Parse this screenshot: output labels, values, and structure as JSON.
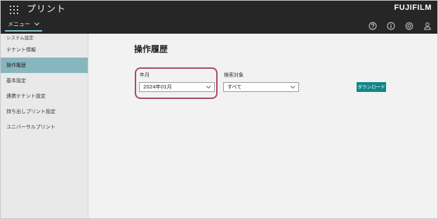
{
  "header": {
    "app_title": "プリント",
    "brand": "FUJIFILM",
    "menu_label": "メニュー"
  },
  "sidebar": {
    "section_label": "システム設定",
    "items": [
      {
        "label": "テナント情報"
      },
      {
        "label": "操作履歴"
      },
      {
        "label": "基本設定"
      },
      {
        "label": "連携テナント設定"
      },
      {
        "label": "持ち出しプリント設定"
      },
      {
        "label": "ユニバーサルプリント"
      }
    ],
    "active_index": 1
  },
  "main": {
    "title": "操作履歴",
    "year_month": {
      "label": "年月",
      "value": "2024年01月"
    },
    "target": {
      "label": "検索対象",
      "value": "すべて"
    },
    "download_label": "ダウンロード"
  },
  "colors": {
    "topbar": "#262626",
    "active_sidebar": "#88b6bf",
    "download_button": "#13858a",
    "highlight_outline": "#a44a72"
  },
  "icons": [
    "apps-grid-icon",
    "chevron-down-icon",
    "help-icon",
    "info-icon",
    "settings-icon",
    "user-icon"
  ]
}
